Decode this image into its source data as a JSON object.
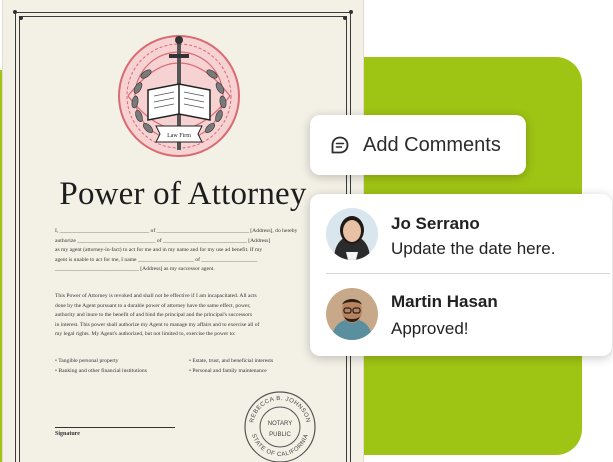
{
  "document": {
    "emblem_banner": "Law Firm",
    "title": "Power of Attorney",
    "paragraph1": [
      "I, ________________________________ of _________________________________ [Address], do hereby",
      "authorize ____________________________ of ______________________________ [Address]",
      "as my agent (attorney-in-fact) to act for me and in my name and for my use ad benefit. If my",
      "agent is unable to act for me, I name ____________________ of ____________________",
      "______________________________ [Address] as my successor agent."
    ],
    "paragraph2": [
      "This Power of Attorney is revoked and shall not be effective if I am incapacitated. All acts",
      "done by the Agent pursuant to a durable power of attorney have the same effect, power,",
      "authority and inure to the benefit of and bind the principal and the principal's successors",
      "in interest. This power shall authorize my Agent to manage my affairs and to exercise all of",
      "my legal rights. My Agent's authorized, but not limited to, exercise the power to:"
    ],
    "list_left": [
      "• Tangible personal property",
      "• Banking and other financial institutions"
    ],
    "list_right": [
      "• Estate, trust, and beneficial interests",
      "• Personal and family maintenance"
    ],
    "signature_label": "Signature",
    "seal": {
      "name": "REBECCA B. JOHNSON",
      "state": "STATE OF CALIFORNIA",
      "center_top": "NOTARY",
      "center_bottom": "PUBLIC"
    }
  },
  "add_comments": {
    "label": "Add Comments",
    "icon": "comment-bubble-icon"
  },
  "comments": [
    {
      "name": "Jo Serrano",
      "text": "Update the date here.",
      "avatar": "avatar-jo-serrano"
    },
    {
      "name": "Martin Hasan",
      "text": "Approved!",
      "avatar": "avatar-martin-hasan"
    }
  ],
  "colors": {
    "accent_green": "#9ec414",
    "paper": "#f3f0e6",
    "emblem_red": "#d96b72",
    "ink": "#1d1d1d"
  }
}
